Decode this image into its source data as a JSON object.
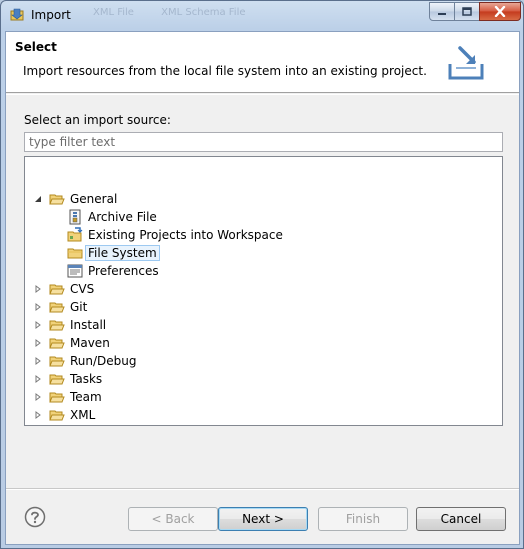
{
  "window": {
    "title": "Import",
    "background_tabs": [
      "XML File",
      "XML Schema File"
    ]
  },
  "banner": {
    "title": "Select",
    "description": "Import resources from the local file system into an existing project."
  },
  "source": {
    "label": "Select an import source:",
    "filter_placeholder": "type filter text"
  },
  "tree": {
    "general": {
      "label": "General",
      "expanded": true,
      "children": [
        {
          "label": "Archive File",
          "icon": "archive-file-icon"
        },
        {
          "label": "Existing Projects into Workspace",
          "icon": "project-import-icon"
        },
        {
          "label": "File System",
          "icon": "folder-icon",
          "selected": true
        },
        {
          "label": "Preferences",
          "icon": "preferences-icon"
        }
      ]
    },
    "categories": [
      "CVS",
      "Git",
      "Install",
      "Maven",
      "Run/Debug",
      "Tasks",
      "Team",
      "XML"
    ]
  },
  "buttons": {
    "back": "< Back",
    "next": "Next >",
    "finish": "Finish",
    "cancel": "Cancel"
  },
  "colors": {
    "selection_bg": "#e8f3fd",
    "selection_border": "#9dc9f1",
    "folder": "#e8c04a",
    "close_button": "#c43a1d"
  }
}
